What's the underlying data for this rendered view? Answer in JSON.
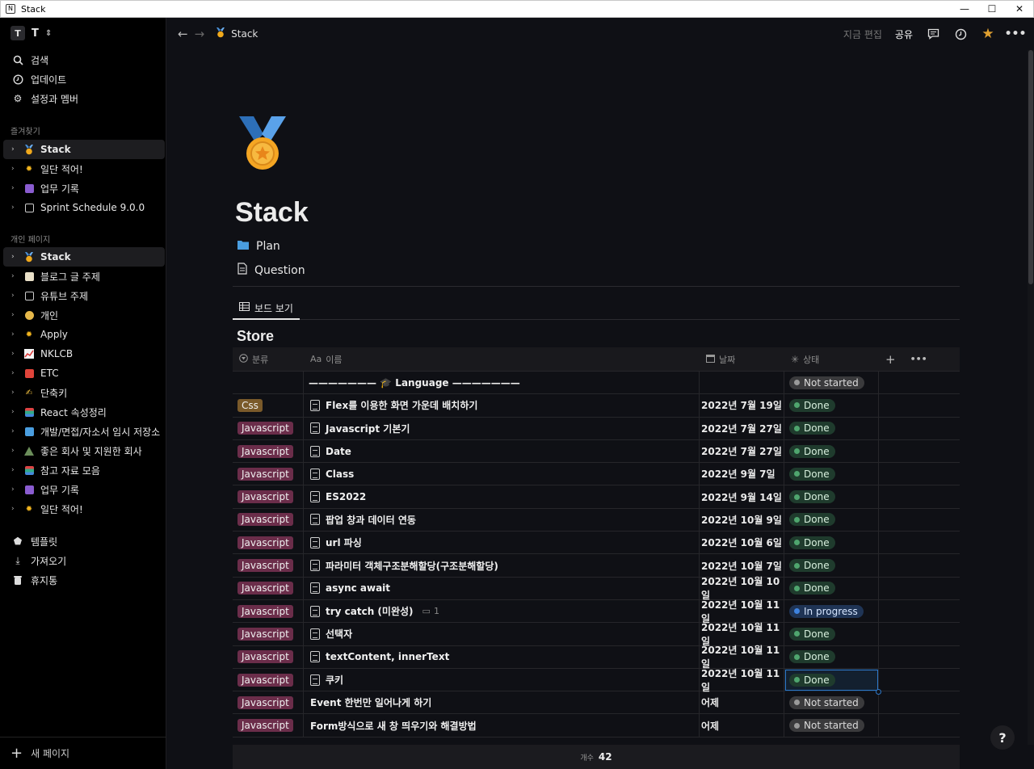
{
  "window": {
    "title": "Stack",
    "controls": [
      "—",
      "☐",
      "✕"
    ]
  },
  "workspace": {
    "letter": "T",
    "name": "T"
  },
  "sidebar": {
    "top": [
      {
        "label": "검색",
        "icon": "search-icon"
      },
      {
        "label": "업데이트",
        "icon": "clock-icon"
      },
      {
        "label": "설정과 멤버",
        "icon": "gear-icon"
      }
    ],
    "favorites_title": "즐겨찾기",
    "favorites": [
      {
        "label": "Stack",
        "icon": "medal",
        "active": true
      },
      {
        "label": "일단 적어!",
        "icon": "sun"
      },
      {
        "label": "업무 기록",
        "icon": "bag"
      },
      {
        "label": "Sprint Schedule 9.0.0",
        "icon": "doc"
      }
    ],
    "private_title": "개인 페이지",
    "private": [
      {
        "label": "Stack",
        "icon": "medal",
        "active": true
      },
      {
        "label": "블로그 글 주제",
        "icon": "memo"
      },
      {
        "label": "유튜브 주제",
        "icon": "doc"
      },
      {
        "label": "개인",
        "icon": "person"
      },
      {
        "label": "Apply",
        "icon": "sun"
      },
      {
        "label": "NKLCB",
        "icon": "chart"
      },
      {
        "label": "ETC",
        "icon": "gift"
      },
      {
        "label": "단축키",
        "icon": "pen"
      },
      {
        "label": "React 속성정리",
        "icon": "books"
      },
      {
        "label": "개발/면접/자소서 임시 저장소",
        "icon": "folder"
      },
      {
        "label": "좋은 회사 및 지원한 회사",
        "icon": "triangle"
      },
      {
        "label": "참고 자료 모음",
        "icon": "books"
      },
      {
        "label": "업무 기록",
        "icon": "bag"
      },
      {
        "label": "일단 적어!",
        "icon": "sun"
      }
    ],
    "bottom": [
      {
        "label": "템플릿",
        "icon": "shapes-icon"
      },
      {
        "label": "가져오기",
        "icon": "download-icon"
      },
      {
        "label": "휴지통",
        "icon": "trash-icon"
      }
    ],
    "new_page": "새 페이지"
  },
  "topbar": {
    "breadcrumb": "Stack",
    "edited": "지금 편집",
    "share": "공유"
  },
  "page": {
    "title": "Stack",
    "links": [
      {
        "label": "Plan",
        "icon": "folder-icon"
      },
      {
        "label": "Question",
        "icon": "doc-icon"
      }
    ],
    "view_tab": "보드 보기",
    "db_title": "Store"
  },
  "table": {
    "headers": {
      "category": "분류",
      "name_prefix": "Aa",
      "name": "이름",
      "date": "날짜",
      "status": "상태"
    },
    "rows": [
      {
        "category": "",
        "name": "——————— 🎓 Language ———————",
        "date": "",
        "status": "Not started",
        "status_type": "ns",
        "doc": false,
        "separator": true
      },
      {
        "category": "Css",
        "name": "Flex를 이용한 화면 가운데 배치하기",
        "date": "2022년 7월 19일",
        "status": "Done",
        "status_type": "done",
        "doc": true
      },
      {
        "category": "Javascript",
        "name": "Javascript 기본기",
        "date": "2022년 7월 27일",
        "status": "Done",
        "status_type": "done",
        "doc": true
      },
      {
        "category": "Javascript",
        "name": "Date",
        "date": "2022년 7월 27일",
        "status": "Done",
        "status_type": "done",
        "doc": true
      },
      {
        "category": "Javascript",
        "name": "Class",
        "date": "2022년 9월 7일",
        "status": "Done",
        "status_type": "done",
        "doc": true
      },
      {
        "category": "Javascript",
        "name": "ES2022",
        "date": "2022년 9월 14일",
        "status": "Done",
        "status_type": "done",
        "doc": true
      },
      {
        "category": "Javascript",
        "name": "팝업 창과 데이터 연동",
        "date": "2022년 10월 9일",
        "status": "Done",
        "status_type": "done",
        "doc": true
      },
      {
        "category": "Javascript",
        "name": "url 파싱",
        "date": "2022년 10월 6일",
        "status": "Done",
        "status_type": "done",
        "doc": true
      },
      {
        "category": "Javascript",
        "name": "파라미터 객체구조분해할당(구조분해할당)",
        "date": "2022년 10월 7일",
        "status": "Done",
        "status_type": "done",
        "doc": true
      },
      {
        "category": "Javascript",
        "name": "async await",
        "date": "2022년 10월 10일",
        "status": "Done",
        "status_type": "done",
        "doc": true
      },
      {
        "category": "Javascript",
        "name": "try catch (미완성)",
        "date": "2022년 10월 11일",
        "status": "In progress",
        "status_type": "ip",
        "doc": true,
        "comments": "1"
      },
      {
        "category": "Javascript",
        "name": "선택자",
        "date": "2022년 10월 11일",
        "status": "Done",
        "status_type": "done",
        "doc": true
      },
      {
        "category": "Javascript",
        "name": "textContent, innerText",
        "date": "2022년 10월 11일",
        "status": "Done",
        "status_type": "done",
        "doc": true
      },
      {
        "category": "Javascript",
        "name": "쿠키",
        "date": "2022년 10월 11일",
        "status": "Done",
        "status_type": "done",
        "doc": true,
        "selected": true
      },
      {
        "category": "Javascript",
        "name": "Event 한번만 일어나게 하기",
        "date": "어제",
        "status": "Not started",
        "status_type": "ns",
        "doc": false
      },
      {
        "category": "Javascript",
        "name": "Form방식으로 새 창 띄우기와 해결방법",
        "date": "어제",
        "status": "Not started",
        "status_type": "ns",
        "doc": false
      }
    ],
    "footer_label": "개수",
    "footer_count": "42"
  },
  "colors": {
    "javascript_tag": "#6b2d4a",
    "css_tag": "#7a5a2a",
    "done": "#4fa56e",
    "in_progress": "#3e83e0",
    "accent_star": "#e0a030"
  }
}
